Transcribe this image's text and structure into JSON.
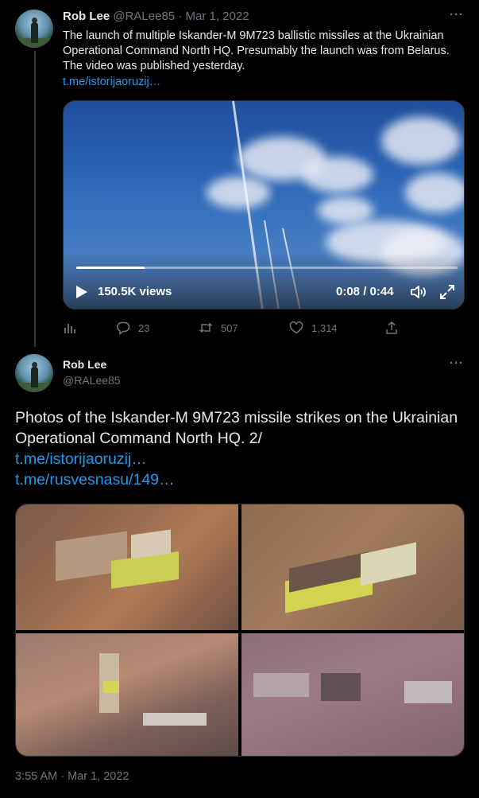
{
  "tweet1": {
    "name": "Rob Lee",
    "handle": "@RALee85",
    "separator": "·",
    "date": "Mar 1, 2022",
    "text": "The launch of multiple Iskander-M 9M723 ballistic missiles at the Ukrainian Operational Command North HQ. Presumably the launch was from Belarus. The video was published yesterday.",
    "link": "t.me/istorijaoruzij…",
    "more": "···",
    "video": {
      "views": "150.5K views",
      "time": "0:08 / 0:44",
      "progress": 0.18
    },
    "actions": {
      "analytics_icon": "analytics-icon",
      "replies": "23",
      "retweets": "507",
      "likes": "1,314",
      "share_icon": "share-icon"
    }
  },
  "tweet2": {
    "name": "Rob Lee",
    "handle": "@RALee85",
    "more": "···",
    "text": "Photos of the Iskander-M 9M723 missile strikes on the Ukrainian Operational Command North HQ. 2/",
    "link1": "t.me/istorijaoruzij…",
    "link2": "t.me/rusvesnasu/149…",
    "timestamp": "3:55 AM · Mar 1, 2022"
  },
  "colors": {
    "background": "#000000",
    "text": "#e7e9ea",
    "secondary": "#71767b",
    "link": "#1d9bf0"
  }
}
